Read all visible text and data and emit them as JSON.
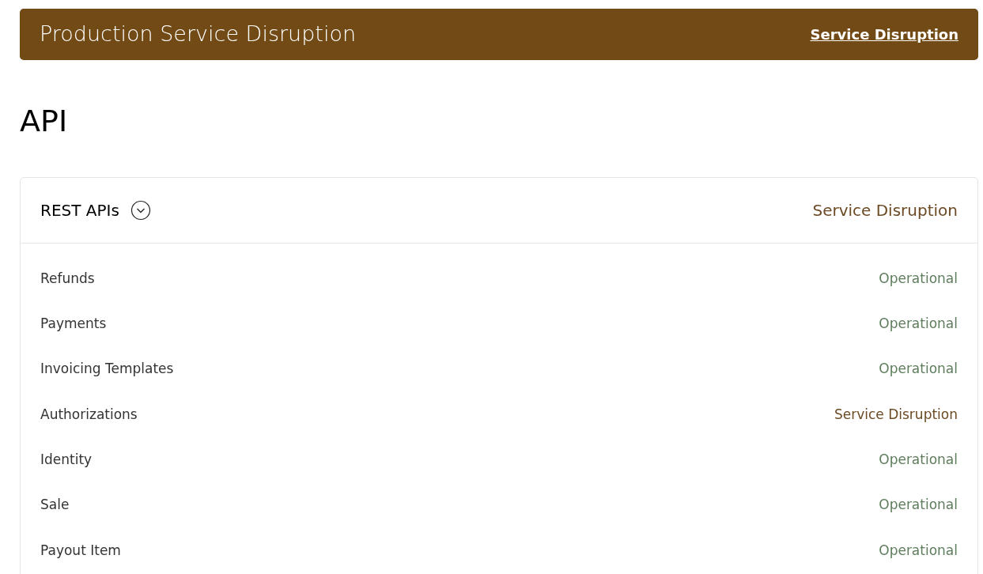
{
  "banner": {
    "title": "Production Service Disruption",
    "status_link": "Service Disruption"
  },
  "section_title": "API",
  "group": {
    "name": "REST APIs",
    "expanded": true,
    "status": {
      "label": "Service Disruption",
      "kind": "disruption"
    },
    "components": [
      {
        "name": "Refunds",
        "status": {
          "label": "Operational",
          "kind": "operational"
        }
      },
      {
        "name": "Payments",
        "status": {
          "label": "Operational",
          "kind": "operational"
        }
      },
      {
        "name": "Invoicing Templates",
        "status": {
          "label": "Operational",
          "kind": "operational"
        }
      },
      {
        "name": "Authorizations",
        "status": {
          "label": "Service Disruption",
          "kind": "disruption"
        }
      },
      {
        "name": "Identity",
        "status": {
          "label": "Operational",
          "kind": "operational"
        }
      },
      {
        "name": "Sale",
        "status": {
          "label": "Operational",
          "kind": "operational"
        }
      },
      {
        "name": "Payout Item",
        "status": {
          "label": "Operational",
          "kind": "operational"
        }
      }
    ]
  }
}
